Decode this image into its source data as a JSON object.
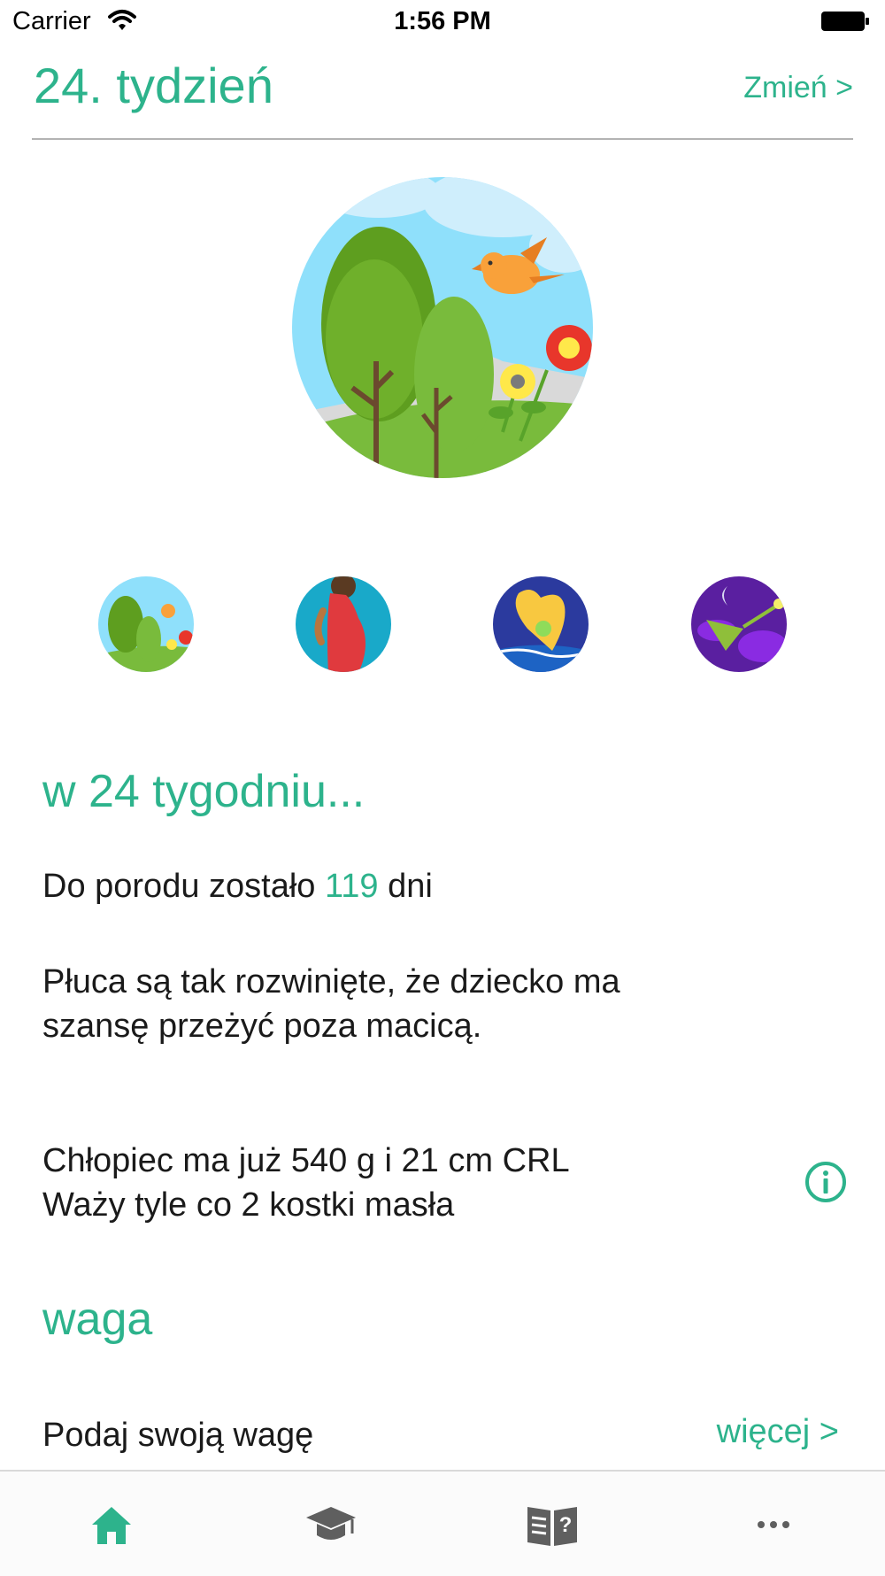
{
  "status_bar": {
    "carrier": "Carrier",
    "time": "1:56 PM"
  },
  "header": {
    "title": "24. tydzień",
    "change_label": "Zmień >"
  },
  "thumbnails": [
    "nature-thumb",
    "pregnant-woman-thumb",
    "baby-heart-thumb",
    "night-bird-thumb"
  ],
  "section_week": {
    "title": "w 24 tygodniu...",
    "countdown_prefix": "Do porodu zostało ",
    "countdown_value": "119",
    "countdown_suffix": " dni",
    "lungs_line1": "Płuca są tak rozwinięte, że dziecko ma",
    "lungs_line2": "szansę przeżyć poza macicą.",
    "size_line1": "Chłopiec ma już 540 g i 21 cm CRL",
    "size_line2": "Waży tyle co 2 kostki masła"
  },
  "section_weight": {
    "title": "waga",
    "prompt": "Podaj swoją wagę",
    "more_label": "więcej >"
  },
  "tabbar": {
    "active_index": 0,
    "items": [
      "home-icon",
      "graduation-cap-icon",
      "book-question-icon",
      "more-dots-icon"
    ]
  },
  "colors": {
    "accent": "#2db38c",
    "text": "#1a1a1a",
    "tab_inactive": "#5f5f5f"
  }
}
